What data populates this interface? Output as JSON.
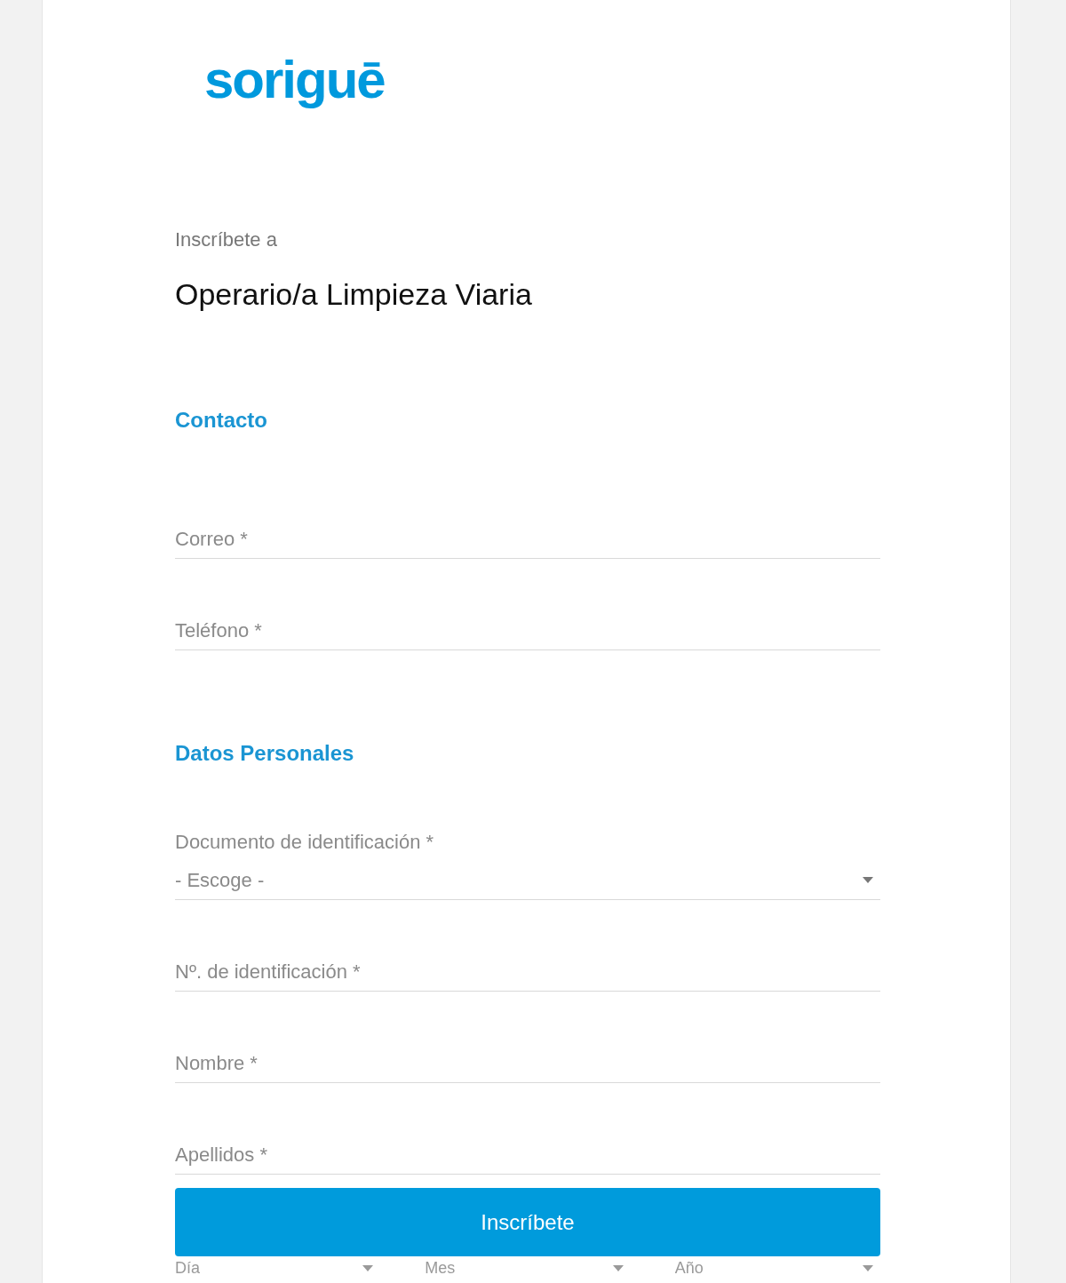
{
  "logo": "soriguē",
  "intro": "Inscríbete a",
  "job_title": "Operario/a Limpieza Viaria",
  "sections": [
    {
      "title": "Contacto",
      "fields": [
        {
          "kind": "text",
          "placeholder": "Correo *"
        },
        {
          "kind": "text",
          "placeholder": "Teléfono *"
        }
      ]
    },
    {
      "title": "Datos Personales",
      "fields": [
        {
          "kind": "select",
          "label": "Documento de identificación *",
          "value": "- Escoge -"
        },
        {
          "kind": "text",
          "placeholder": "Nº. de identificación *"
        },
        {
          "kind": "text",
          "placeholder": "Nombre *"
        },
        {
          "kind": "text",
          "placeholder": "Apellidos *"
        }
      ]
    }
  ],
  "submit": "Inscríbete",
  "date_fields": [
    "Día",
    "Mes",
    "Año"
  ]
}
